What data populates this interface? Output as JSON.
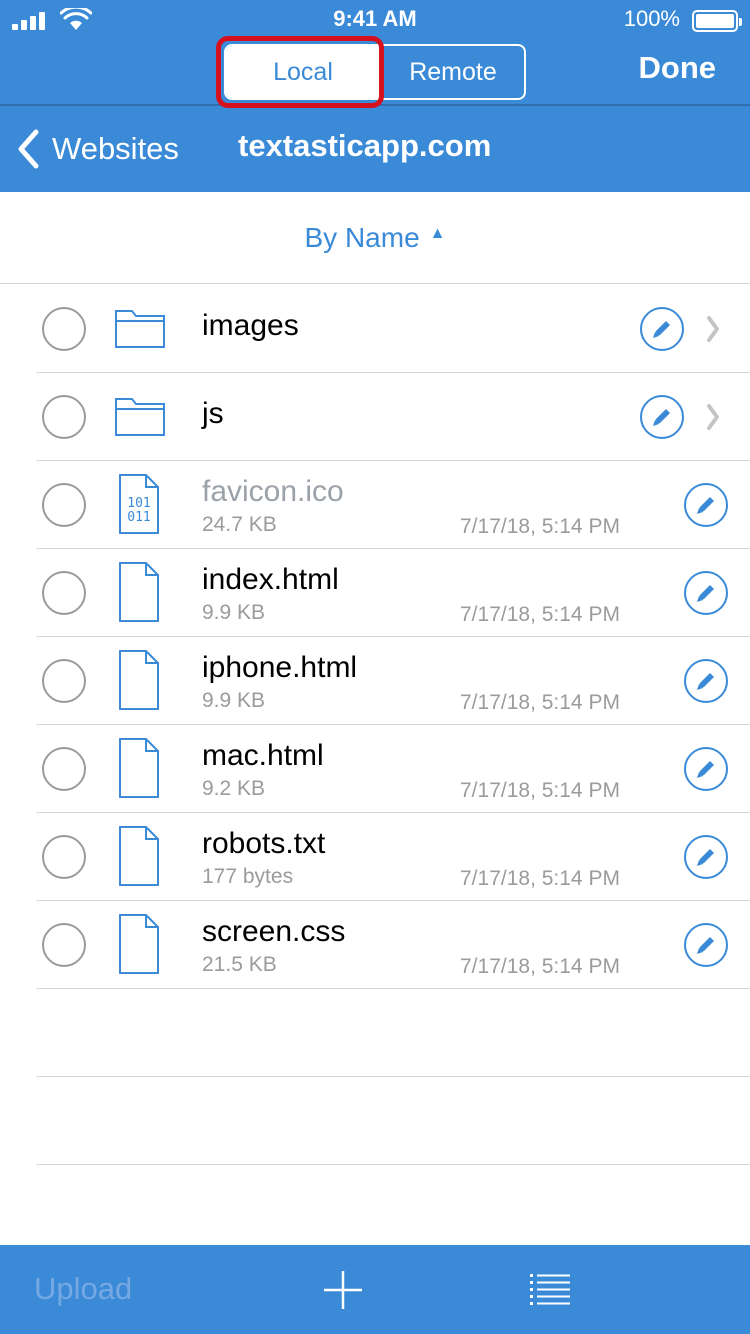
{
  "status": {
    "time": "9:41 AM",
    "battery": "100%",
    "battery_level": 1.0
  },
  "segmented": {
    "local": "Local",
    "remote": "Remote",
    "selected": "Local"
  },
  "nav": {
    "done": "Done",
    "back": "Websites",
    "title": "textasticapp.com"
  },
  "sort": {
    "label": "By Name",
    "caret": "▲"
  },
  "items": [
    {
      "type": "folder",
      "name": "images"
    },
    {
      "type": "folder",
      "name": "js"
    },
    {
      "type": "binary",
      "name": "favicon.ico",
      "size": "24.7 KB",
      "date": "7/17/18, 5:14 PM",
      "icon_text_1": "101",
      "icon_text_2": "011"
    },
    {
      "type": "file",
      "name": "index.html",
      "size": "9.9 KB",
      "date": "7/17/18, 5:14 PM"
    },
    {
      "type": "file",
      "name": "iphone.html",
      "size": "9.9 KB",
      "date": "7/17/18, 5:14 PM"
    },
    {
      "type": "file",
      "name": "mac.html",
      "size": "9.2 KB",
      "date": "7/17/18, 5:14 PM"
    },
    {
      "type": "file",
      "name": "robots.txt",
      "size": "177 bytes",
      "date": "7/17/18, 5:14 PM"
    },
    {
      "type": "file",
      "name": "screen.css",
      "size": "21.5 KB",
      "date": "7/17/18, 5:14 PM"
    }
  ],
  "toolbar": {
    "upload": "Upload"
  },
  "colors": {
    "accent": "#3a8ad8",
    "highlight": "#d7101e",
    "disabled_text": "#76a9e2"
  }
}
